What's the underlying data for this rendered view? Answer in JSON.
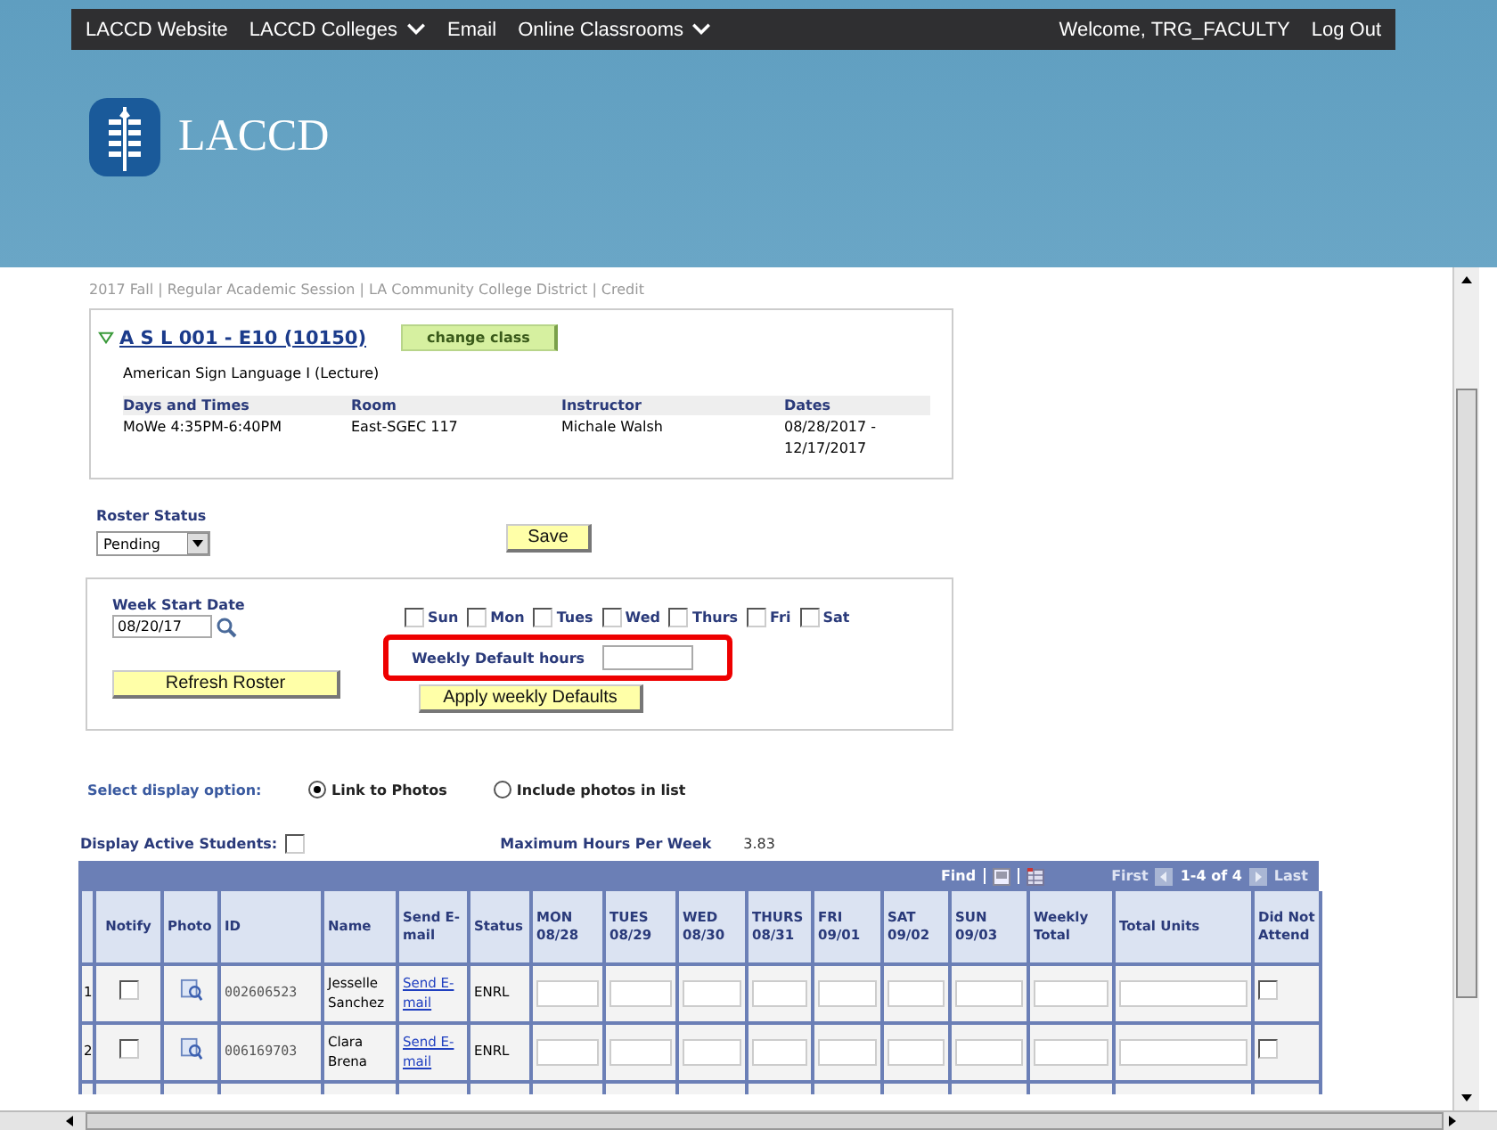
{
  "top_nav": {
    "items": [
      {
        "label": "LACCD Website",
        "dropdown": false
      },
      {
        "label": "LACCD Colleges",
        "dropdown": true
      },
      {
        "label": "Email",
        "dropdown": false
      },
      {
        "label": "Online Classrooms",
        "dropdown": true
      }
    ],
    "welcome": "Welcome, TRG_FACULTY",
    "logout": "Log Out"
  },
  "logo": {
    "text": "LACCD"
  },
  "breadcrumb": "2017 Fall | Regular Academic Session | LA Community College District | Credit",
  "class_info": {
    "expanded": true,
    "title": "A S L 001 - E10 (10150)",
    "change_button": "change class",
    "description": "American Sign Language I (Lecture)",
    "columns": [
      "Days and Times",
      "Room",
      "Instructor",
      "Dates"
    ],
    "values": [
      "MoWe 4:35PM-6:40PM",
      "East-SGEC 117",
      "Michale Walsh",
      "08/28/2017 - 12/17/2017"
    ]
  },
  "roster_status": {
    "label": "Roster Status",
    "value": "Pending",
    "save_button": "Save"
  },
  "week": {
    "label": "Week Start Date",
    "date": "08/20/17",
    "days": [
      {
        "label": "Sun",
        "checked": false
      },
      {
        "label": "Mon",
        "checked": false
      },
      {
        "label": "Tues",
        "checked": false
      },
      {
        "label": "Wed",
        "checked": false
      },
      {
        "label": "Thurs",
        "checked": false
      },
      {
        "label": "Fri",
        "checked": false
      },
      {
        "label": "Sat",
        "checked": false
      }
    ],
    "default_hours_label": "Weekly Default hours",
    "refresh_button": "Refresh Roster",
    "apply_button": "Apply weekly Defaults"
  },
  "annotation": {
    "kind": "highlight"
  },
  "display_option": {
    "label": "Select display option:",
    "options": [
      {
        "label": "Link to Photos",
        "selected": true
      },
      {
        "label": "Include photos in list",
        "selected": false
      }
    ]
  },
  "display_active": {
    "label": "Display Active Students:",
    "checked": false
  },
  "max_hours": {
    "label": "Maximum Hours Per Week",
    "value": "3.83"
  },
  "table": {
    "toolbar": {
      "find": "Find",
      "first": "First",
      "range": "1-4 of 4",
      "last": "Last"
    },
    "columns": [
      "",
      "Notify",
      "Photo",
      "ID",
      "Name",
      "Send E-mail",
      "Status",
      "MON 08/28",
      "TUES 08/29",
      "WED 08/30",
      "THURS 08/31",
      "FRI 09/01",
      "SAT 09/02",
      "SUN 09/03",
      "Weekly Total",
      "Total Units",
      "Did Not Attend"
    ],
    "rows": [
      {
        "num": "1",
        "notify": false,
        "id": "002606523",
        "name": "Jesselle Sanchez",
        "email": "Send E-mail",
        "status": "ENRL",
        "did_not_attend": false
      },
      {
        "num": "2",
        "notify": false,
        "id": "006169703",
        "name": "Clara Brena",
        "email": "Send E-mail",
        "status": "ENRL",
        "did_not_attend": false
      }
    ]
  }
}
